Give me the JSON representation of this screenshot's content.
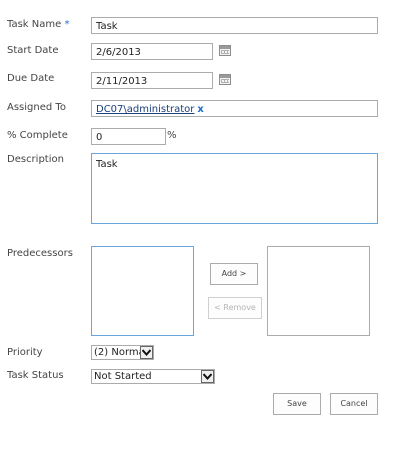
{
  "form": {
    "task_name": {
      "label": "Task Name",
      "required_marker": "*",
      "value": "Task"
    },
    "start_date": {
      "label": "Start Date",
      "value": "2/6/2013",
      "icon": "calendar-icon"
    },
    "due_date": {
      "label": "Due Date",
      "value": "2/11/2013",
      "icon": "calendar-icon"
    },
    "assigned_to": {
      "label": "Assigned To",
      "value": "DC07\\administrator",
      "remove": "x"
    },
    "percent_complete": {
      "label": "% Complete",
      "value": "0",
      "unit": "%"
    },
    "description": {
      "label": "Description",
      "value": "Task"
    },
    "predecessors": {
      "label": "Predecessors",
      "add_label": "Add >",
      "remove_label": "< Remove"
    },
    "priority": {
      "label": "Priority",
      "selected": "(2) Normal"
    },
    "task_status": {
      "label": "Task Status",
      "selected": "Not Started"
    }
  },
  "actions": {
    "save_label": "Save",
    "cancel_label": "Cancel"
  },
  "colors": {
    "accent": "#1e6bc9",
    "focus_border": "#6aa6de",
    "border": "#ababab",
    "label": "#444444"
  }
}
